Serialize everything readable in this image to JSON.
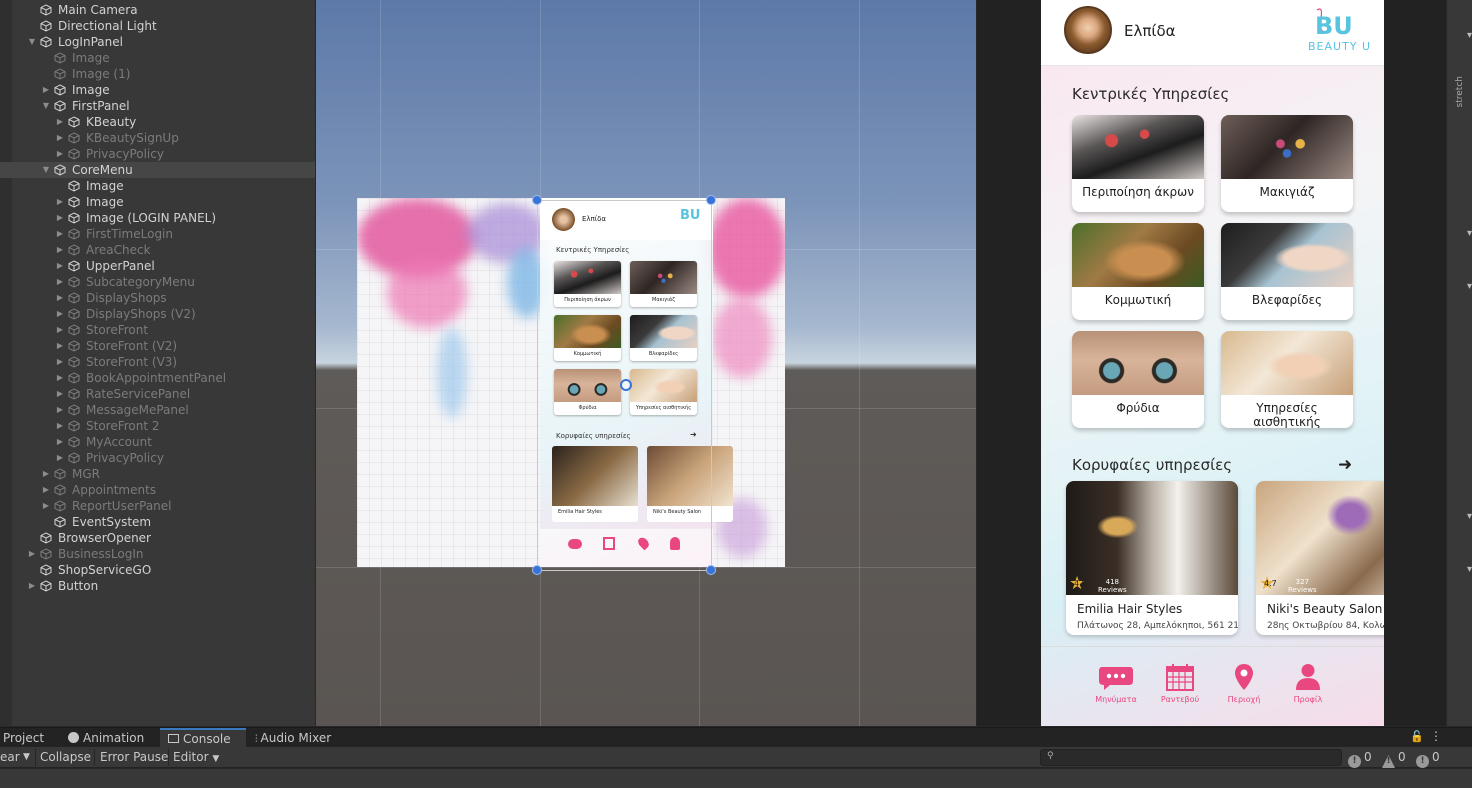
{
  "hierarchy": {
    "items": [
      {
        "label": "Main Camera",
        "depth": 0,
        "arrow": "",
        "state": "normal"
      },
      {
        "label": "Directional Light",
        "depth": 0,
        "arrow": "",
        "state": "normal"
      },
      {
        "label": "LogInPanel",
        "depth": 0,
        "arrow": "down",
        "state": "normal"
      },
      {
        "label": "Image",
        "depth": 1,
        "arrow": "",
        "state": "disabled"
      },
      {
        "label": "Image (1)",
        "depth": 1,
        "arrow": "",
        "state": "disabled"
      },
      {
        "label": "Image",
        "depth": 1,
        "arrow": "right",
        "state": "normal"
      },
      {
        "label": "FirstPanel",
        "depth": 1,
        "arrow": "down",
        "state": "normal"
      },
      {
        "label": "KBeauty",
        "depth": 2,
        "arrow": "right",
        "state": "normal"
      },
      {
        "label": "KBeautySignUp",
        "depth": 2,
        "arrow": "right",
        "state": "disabled"
      },
      {
        "label": "PrivacyPolicy",
        "depth": 2,
        "arrow": "right",
        "state": "disabled"
      },
      {
        "label": "CoreMenu",
        "depth": 1,
        "arrow": "down",
        "state": "selected"
      },
      {
        "label": "Image",
        "depth": 2,
        "arrow": "",
        "state": "normal"
      },
      {
        "label": "Image",
        "depth": 2,
        "arrow": "right",
        "state": "normal"
      },
      {
        "label": "Image (LOGIN PANEL)",
        "depth": 2,
        "arrow": "right",
        "state": "normal"
      },
      {
        "label": "FirstTimeLogin",
        "depth": 2,
        "arrow": "right",
        "state": "disabled"
      },
      {
        "label": "AreaCheck",
        "depth": 2,
        "arrow": "right",
        "state": "disabled"
      },
      {
        "label": "UpperPanel",
        "depth": 2,
        "arrow": "right",
        "state": "normal"
      },
      {
        "label": "SubcategoryMenu",
        "depth": 2,
        "arrow": "right",
        "state": "disabled"
      },
      {
        "label": "DisplayShops",
        "depth": 2,
        "arrow": "right",
        "state": "disabled"
      },
      {
        "label": "DisplayShops (V2)",
        "depth": 2,
        "arrow": "right",
        "state": "disabled"
      },
      {
        "label": "StoreFront",
        "depth": 2,
        "arrow": "right",
        "state": "disabled"
      },
      {
        "label": "StoreFront (V2)",
        "depth": 2,
        "arrow": "right",
        "state": "disabled"
      },
      {
        "label": "StoreFront (V3)",
        "depth": 2,
        "arrow": "right",
        "state": "disabled"
      },
      {
        "label": "BookAppointmentPanel",
        "depth": 2,
        "arrow": "right",
        "state": "disabled"
      },
      {
        "label": "RateServicePanel",
        "depth": 2,
        "arrow": "right",
        "state": "disabled"
      },
      {
        "label": "MessageMePanel",
        "depth": 2,
        "arrow": "right",
        "state": "disabled"
      },
      {
        "label": "StoreFront 2",
        "depth": 2,
        "arrow": "right",
        "state": "disabled"
      },
      {
        "label": "MyAccount",
        "depth": 2,
        "arrow": "right",
        "state": "disabled"
      },
      {
        "label": "PrivacyPolicy",
        "depth": 2,
        "arrow": "right",
        "state": "disabled"
      },
      {
        "label": "MGR",
        "depth": 1,
        "arrow": "right",
        "state": "disabled"
      },
      {
        "label": "Appointments",
        "depth": 1,
        "arrow": "right",
        "state": "disabled"
      },
      {
        "label": "ReportUserPanel",
        "depth": 1,
        "arrow": "right",
        "state": "disabled"
      },
      {
        "label": "EventSystem",
        "depth": 1,
        "arrow": "",
        "state": "normal"
      },
      {
        "label": "BrowserOpener",
        "depth": 0,
        "arrow": "",
        "state": "normal"
      },
      {
        "label": "BusinessLogIn",
        "depth": 0,
        "arrow": "right",
        "state": "disabled"
      },
      {
        "label": "ShopServiceGO",
        "depth": 0,
        "arrow": "",
        "state": "normal"
      },
      {
        "label": "Button",
        "depth": 0,
        "arrow": "right",
        "state": "normal"
      }
    ]
  },
  "app": {
    "user_name": "Ελπίδα",
    "logo_text": "BU",
    "logo_sub": "BEAUTY U",
    "core_title": "Κεντρικές Υπηρεσίες",
    "services": [
      {
        "label": "Περιποίηση άκρων",
        "photo": "nails"
      },
      {
        "label": "Μακιγιάζ",
        "photo": "makeup"
      },
      {
        "label": "Κομμωτική",
        "photo": "hair"
      },
      {
        "label": "Βλεφαρίδες",
        "photo": "lashes"
      },
      {
        "label": "Φρύδια",
        "photo": "brows"
      },
      {
        "label": "Υπηρεσίες αισθητικής",
        "photo": "facial"
      }
    ],
    "top_title": "Κορυφαίες υπηρεσίες",
    "top_arrow": "arrow-right-icon",
    "salons": [
      {
        "name": "Emilia Hair Styles",
        "address": "Πλάτωνος 28, Αμπελόκηποι, 561 21",
        "rating": "4.9",
        "reviews": "418",
        "reviews_label": "Reviews"
      },
      {
        "name": "Niki's Beauty Salon",
        "address": "28ης Οκτωβρίου 84, Κολωνάκι",
        "rating": "4.7",
        "reviews": "327",
        "reviews_label": "Reviews"
      }
    ],
    "nav": [
      {
        "label": "Μηνύματα",
        "icon": "chat-icon"
      },
      {
        "label": "Ραντεβού",
        "icon": "calendar-icon"
      },
      {
        "label": "Περιοχή",
        "icon": "location-pin-icon"
      },
      {
        "label": "Προφίλ",
        "icon": "user-icon"
      }
    ],
    "accent": "#e8477f",
    "logo_color": "#58c4df"
  },
  "inspector": {
    "stretch_label": "stretch"
  },
  "tabs": [
    {
      "label": "Project",
      "icon": "folder-icon"
    },
    {
      "label": "Animation",
      "icon": "clock-icon"
    },
    {
      "label": "Console",
      "icon": "console-icon",
      "active": true
    },
    {
      "label": "Audio Mixer",
      "icon": "mixer-icon"
    }
  ],
  "console_toolbar": {
    "clear": "ear",
    "collapse": "Collapse",
    "error_pause": "Error Pause",
    "editor": "Editor",
    "log_count": "0",
    "warn_count": "0",
    "error_count": "0"
  }
}
